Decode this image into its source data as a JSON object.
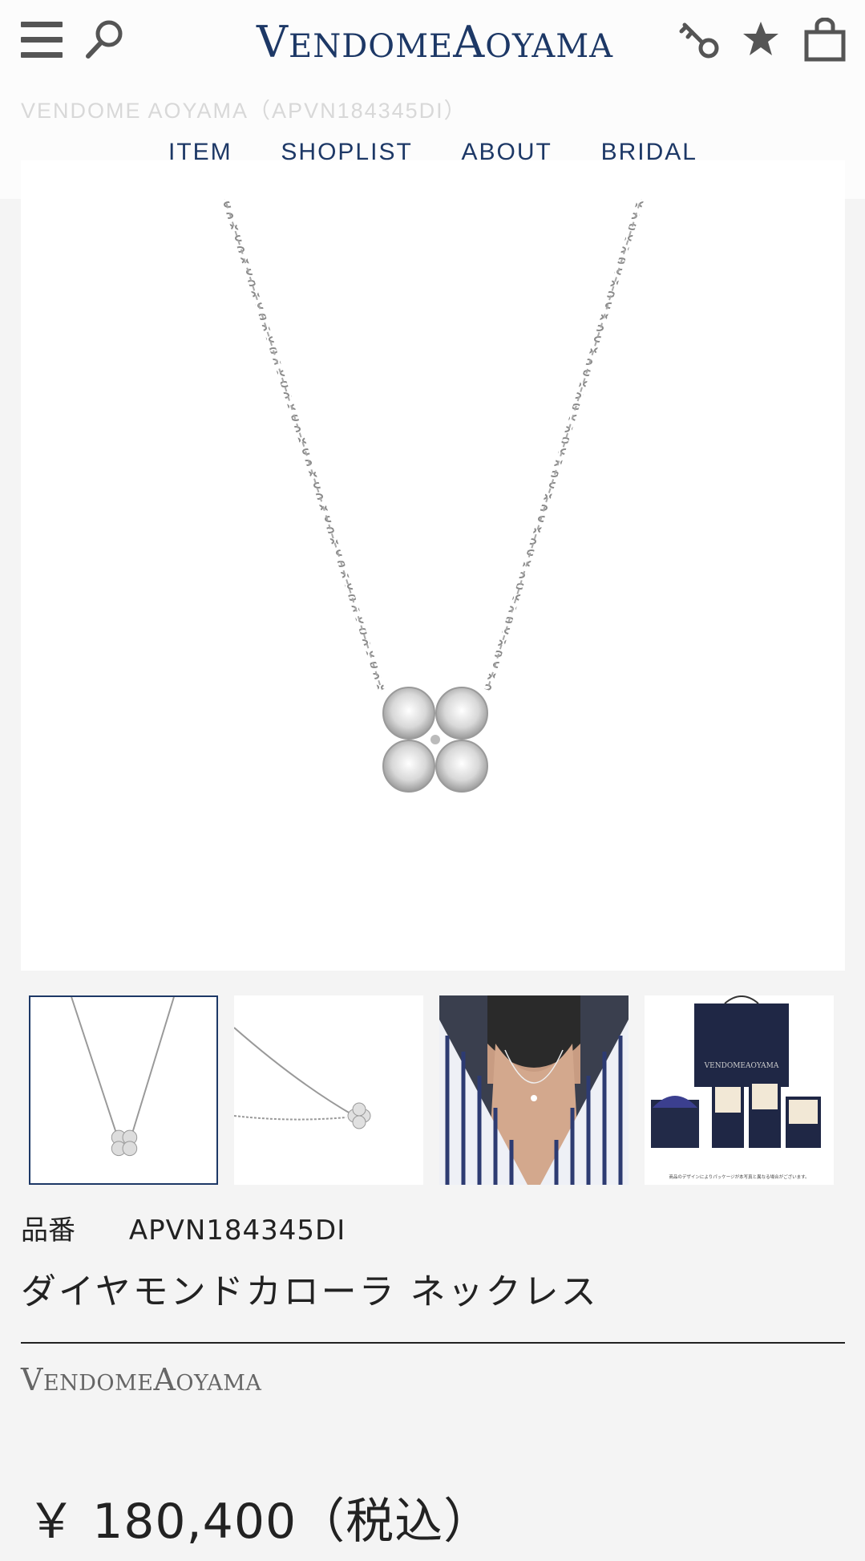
{
  "header": {
    "logo_v": "V",
    "logo_endome": "ENDOME",
    "logo_a": "A",
    "logo_oyama": "OYAMA",
    "icons": [
      "hamburger-menu-icon",
      "search-icon",
      "key-icon",
      "star-icon",
      "shopping-bag-icon"
    ]
  },
  "breadcrumb": "VENDOME AOYAMA（APVN184345DI）",
  "nav": {
    "items": [
      "ITEM",
      "SHOPLIST",
      "ABOUT",
      "BRIDAL"
    ]
  },
  "thumbnails": {
    "thumb4_text": "VENDOMEAOYAMA",
    "thumb4_caption": "商品のデザインによりパッケージが本写真と異なる場合がございます。"
  },
  "product": {
    "number_label": "品番",
    "number": "APVN184345DI",
    "name": "ダイヤモンドカローラ ネックレス",
    "brand_v": "V",
    "brand_endome": "ENDOME",
    "brand_a": "A",
    "brand_oyama": "OYAMA",
    "price": "￥ 180,400（税込）"
  },
  "colors": {
    "brand_navy": "#1d3866",
    "background": "#f4f4f4"
  }
}
